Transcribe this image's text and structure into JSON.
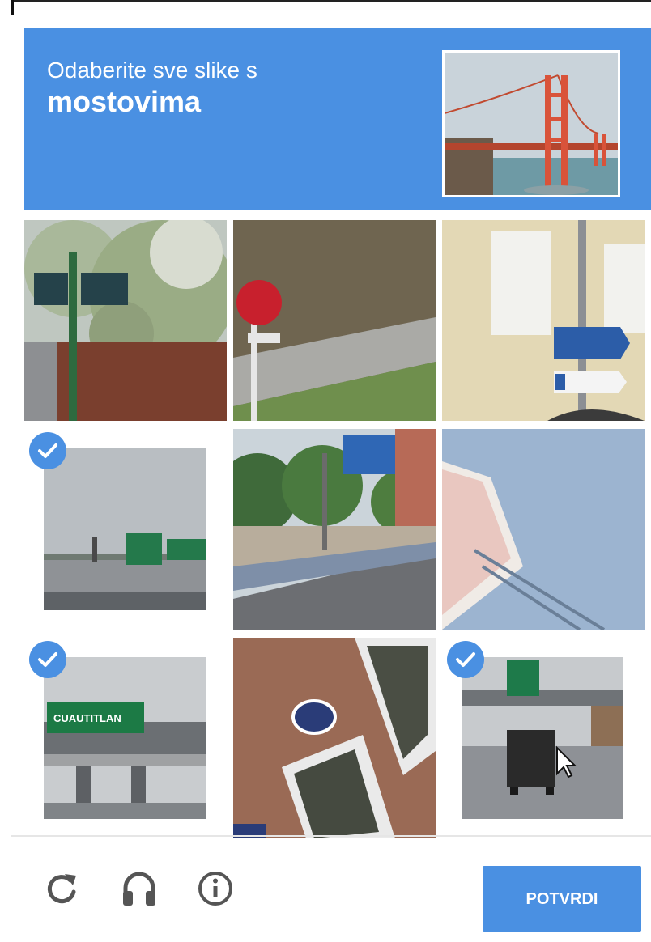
{
  "challenge": {
    "instruction_line1": "Odaberite sve slike s",
    "instruction_line2": "mostovima",
    "sample_image": "golden-gate-bridge"
  },
  "tiles": [
    {
      "subject": "street-signs-with-flowers",
      "selected": false
    },
    {
      "subject": "red-sign-roadside",
      "selected": false
    },
    {
      "subject": "building-with-direction-signs",
      "selected": false
    },
    {
      "subject": "highway-overpass-signs",
      "selected": true
    },
    {
      "subject": "street-with-blue-sign",
      "selected": false
    },
    {
      "subject": "tilted-store-sign",
      "selected": false
    },
    {
      "subject": "overpass-cuautitlan-sign",
      "selected": true,
      "sign_text": "CUAUTITLAN"
    },
    {
      "subject": "brick-building-windows",
      "selected": false
    },
    {
      "subject": "highway-truck-overpass",
      "selected": true
    }
  ],
  "footer": {
    "reload_icon": "reload-icon",
    "audio_icon": "headphones-icon",
    "info_icon": "info-icon",
    "verify_label": "POTVRDI"
  },
  "colors": {
    "accent": "#4a90e2"
  }
}
